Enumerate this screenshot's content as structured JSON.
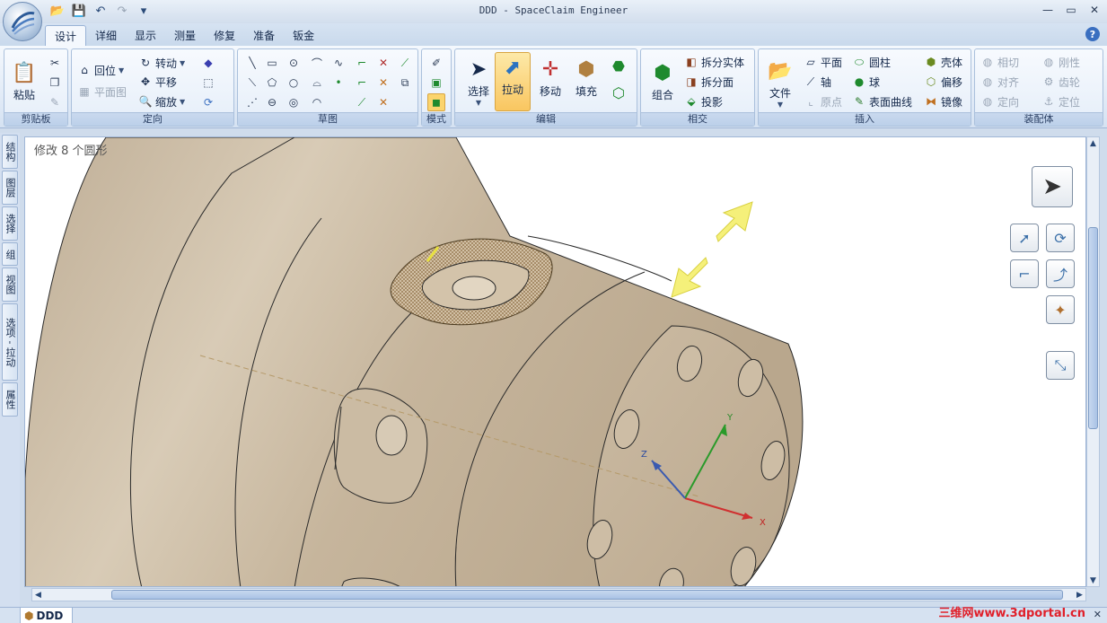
{
  "window": {
    "title": "DDD - SpaceClaim Engineer",
    "minimize": "—",
    "maximize": "▭",
    "close": "✕"
  },
  "qat": {
    "open": "📂",
    "save": "💾",
    "undo": "↶",
    "redo": "↷",
    "more": "▾"
  },
  "tabs": [
    "设计",
    "详细",
    "显示",
    "测量",
    "修复",
    "准备",
    "钣金"
  ],
  "help": "?",
  "ribbon": {
    "clipboard": {
      "label": "剪贴板",
      "paste": "粘贴"
    },
    "orient": {
      "label": "定向",
      "home": "回位",
      "plan": "平面图",
      "spin": "转动",
      "pan": "平移",
      "zoom": "缩放"
    },
    "sketch": {
      "label": "草图"
    },
    "mode": {
      "label": "模式"
    },
    "edit": {
      "label": "编辑",
      "select": "选择",
      "pull": "拉动",
      "move": "移动",
      "fill": "填充"
    },
    "intersect": {
      "label": "相交",
      "combine": "组合",
      "split_body": "拆分实体",
      "split_face": "拆分面",
      "project": "投影"
    },
    "insert": {
      "label": "插入",
      "file": "文件",
      "plane": "平面",
      "axis": "轴",
      "origin": "原点",
      "cylinder": "圆柱",
      "sphere": "球",
      "surface_curve": "表面曲线",
      "shell": "壳体",
      "offset": "偏移",
      "mirror": "镜像"
    },
    "assembly": {
      "label": "装配体",
      "tangent": "相切",
      "rigid": "刚性",
      "align": "对齐",
      "gear": "齿轮",
      "orient": "定向",
      "anchor": "定位"
    }
  },
  "side_tabs": [
    "结构",
    "图层",
    "选择",
    "组",
    "视图",
    "选项 - 拉动",
    "属性"
  ],
  "viewport": {
    "status": "修改 8 个圆形"
  },
  "axes": {
    "x": "X",
    "y": "Y",
    "z": "Z"
  },
  "document": {
    "tab": "DDD"
  },
  "watermark": "三维网www.3dportal.cn",
  "colors": {
    "model": "#cbbba3",
    "accent": "#3a6fc0",
    "pull_active": "#f9c660",
    "arrow": "#f5f07a"
  }
}
